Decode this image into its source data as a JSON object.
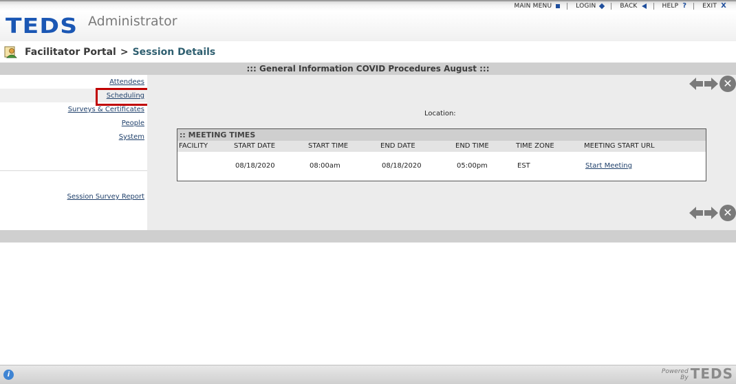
{
  "topnav": {
    "items": [
      {
        "label": "MAIN MENU",
        "icon": "square-icon"
      },
      {
        "label": "LOGIN",
        "icon": "diamond-icon"
      },
      {
        "label": "BACK",
        "icon": "back-triangle-icon"
      },
      {
        "label": "HELP",
        "icon": "question-icon",
        "glyph": "?"
      },
      {
        "label": "EXIT",
        "icon": "close-x-icon",
        "glyph": "X"
      }
    ]
  },
  "header": {
    "logo_text": "TEDS",
    "app_name": "Administrator"
  },
  "breadcrumb": {
    "parent": "Facilitator Portal",
    "separator": ">",
    "current": "Session Details"
  },
  "title_bar": {
    "text": "::: General Information COVID Procedures August :::"
  },
  "sidebar": {
    "links": [
      "Attendees",
      "Scheduling",
      "Surveys & Certificates",
      "People",
      "System"
    ],
    "active": "Scheduling",
    "report_link": "Session Survey Report"
  },
  "main": {
    "location_label": "Location:",
    "nav_close_glyph": "✕",
    "meeting_times": {
      "title": ":: MEETING TIMES",
      "columns": [
        "FACILITY",
        "START DATE",
        "START TIME",
        "END DATE",
        "END TIME",
        "TIME ZONE",
        "MEETING START URL"
      ],
      "rows": [
        {
          "facility": "",
          "start_date": "08/18/2020",
          "start_time": "08:00am",
          "end_date": "08/18/2020",
          "end_time": "05:00pm",
          "time_zone": "EST",
          "url_label": "Start Meeting"
        }
      ]
    }
  },
  "footer": {
    "info_glyph": "i",
    "powered_line1": "Powered",
    "powered_line2": "By",
    "powered_logo": "TEDS"
  },
  "colors": {
    "brand_blue": "#1b57b4",
    "link": "#1e3f6a",
    "highlight": "#c00000",
    "bar_gray": "#cfcfcf"
  }
}
